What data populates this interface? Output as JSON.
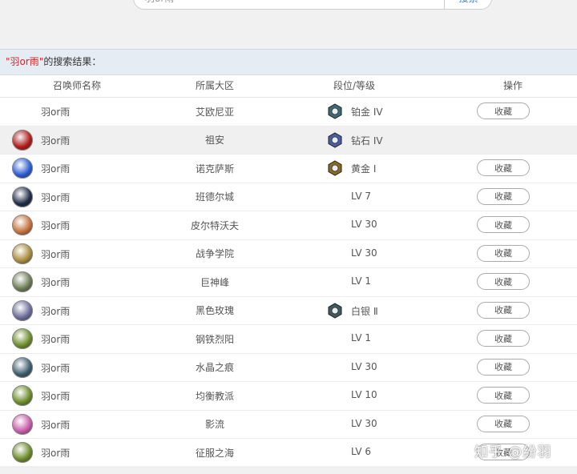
{
  "search": {
    "value": "羽or雨",
    "button_label": "搜索"
  },
  "results": {
    "quote_open": "\"",
    "keyword": "羽or雨",
    "quote_close": "\"",
    "suffix": "的搜索结果："
  },
  "columns": {
    "summoner": "召唤师名称",
    "server": "所属大区",
    "rank": "段位/等级",
    "action": "操作"
  },
  "rows": [
    {
      "name": "羽or雨",
      "server": "艾欧尼亚",
      "rank": "铂金 IV",
      "rank_icon": "platinum-badge-icon",
      "rank_color": "#3e6a78",
      "avatar": null,
      "action": "收藏"
    },
    {
      "name": "羽or雨",
      "server": "祖安",
      "rank": "钻石 IV",
      "rank_icon": "diamond-badge-icon",
      "rank_color": "#4a5ea8",
      "avatar": "#b01818",
      "action": null
    },
    {
      "name": "羽or雨",
      "server": "诺克萨斯",
      "rank": "黄金 Ⅰ",
      "rank_icon": "gold-badge-icon",
      "rank_color": "#8a6a22",
      "avatar": "#2a5ad0",
      "action": "收藏"
    },
    {
      "name": "羽or雨",
      "server": "班德尔城",
      "rank": "LV 7",
      "rank_icon": null,
      "rank_color": null,
      "avatar": "#1c2a44",
      "action": "收藏"
    },
    {
      "name": "羽or雨",
      "server": "皮尔特沃夫",
      "rank": "LV 30",
      "rank_icon": null,
      "rank_color": null,
      "avatar": "#c2703a",
      "action": "收藏"
    },
    {
      "name": "羽or雨",
      "server": "战争学院",
      "rank": "LV 30",
      "rank_icon": null,
      "rank_color": null,
      "avatar": "#a88a3a",
      "action": "收藏"
    },
    {
      "name": "羽or雨",
      "server": "巨神峰",
      "rank": "LV 1",
      "rank_icon": null,
      "rank_color": null,
      "avatar": "#6a7a52",
      "action": "收藏"
    },
    {
      "name": "羽or雨",
      "server": "黑色玫瑰",
      "rank": "白银 Ⅱ",
      "rank_icon": "silver-badge-icon",
      "rank_color": "#3e5a5e",
      "avatar": "#6a6a98",
      "action": "收藏"
    },
    {
      "name": "羽or雨",
      "server": "钢铁烈阳",
      "rank": "LV 1",
      "rank_icon": null,
      "rank_color": null,
      "avatar": "#6a8a28",
      "action": "收藏"
    },
    {
      "name": "羽or雨",
      "server": "水晶之痕",
      "rank": "LV 30",
      "rank_icon": null,
      "rank_color": null,
      "avatar": "#3a5a6a",
      "action": "收藏"
    },
    {
      "name": "羽or雨",
      "server": "均衡教派",
      "rank": "LV 10",
      "rank_icon": null,
      "rank_color": null,
      "avatar": "#6a8a28",
      "action": "收藏"
    },
    {
      "name": "羽or雨",
      "server": "影流",
      "rank": "LV 30",
      "rank_icon": null,
      "rank_color": null,
      "avatar": "#c85aa8",
      "action": "收藏"
    },
    {
      "name": "羽or雨",
      "server": "征服之海",
      "rank": "LV 6",
      "rank_icon": null,
      "rank_color": null,
      "avatar": "#6a8a28",
      "action": "收藏"
    }
  ],
  "watermark": "知乎 @纷羽"
}
